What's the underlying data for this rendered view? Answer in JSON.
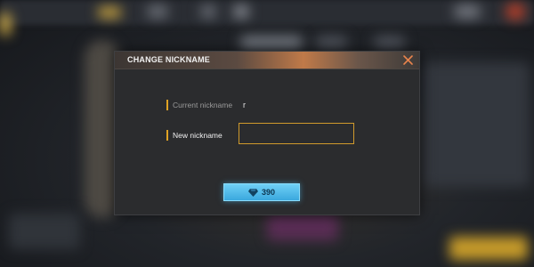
{
  "dialog": {
    "title": "CHANGE NICKNAME",
    "current_label": "Current nickname",
    "current_value": "r",
    "new_label": "New nickname",
    "new_value": "",
    "close_icon": "close-icon",
    "purchase": {
      "price": "390",
      "currency_icon": "diamond-icon"
    }
  },
  "colors": {
    "accent": "#e0a324",
    "button": "#4ab6e8",
    "close": "#e9844c"
  }
}
